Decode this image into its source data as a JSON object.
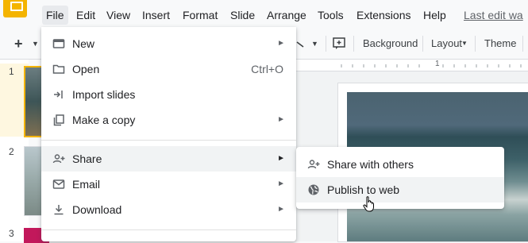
{
  "menubar": {
    "items": [
      "File",
      "Edit",
      "View",
      "Insert",
      "Format",
      "Slide",
      "Arrange",
      "Tools",
      "Extensions",
      "Help"
    ],
    "last_edit": "Last edit wa"
  },
  "toolbar": {
    "add": "+",
    "background": "Background",
    "layout": "Layout",
    "theme": "Theme"
  },
  "filmstrip": {
    "numbers": [
      "1",
      "2",
      "3"
    ]
  },
  "ruler": {
    "mark": "1"
  },
  "file_menu": {
    "items": [
      {
        "label": "New",
        "icon": "new-presentation-icon",
        "submenu": true
      },
      {
        "label": "Open",
        "icon": "folder-icon",
        "shortcut": "Ctrl+O"
      },
      {
        "label": "Import slides",
        "icon": "import-icon"
      },
      {
        "label": "Make a copy",
        "icon": "copy-icon",
        "submenu": true
      },
      {
        "label": "Share",
        "icon": "share-person-icon",
        "submenu": true,
        "highlighted": true
      },
      {
        "label": "Email",
        "icon": "email-icon",
        "submenu": true
      },
      {
        "label": "Download",
        "icon": "download-icon",
        "submenu": true
      }
    ]
  },
  "share_submenu": {
    "items": [
      {
        "label": "Share with others",
        "icon": "share-person-icon"
      },
      {
        "label": "Publish to web",
        "icon": "globe-icon",
        "highlighted": true
      }
    ]
  },
  "colors": {
    "accent": "#f4b400",
    "menu_hover": "#f1f3f4",
    "active_bg": "#e8eaed",
    "selected_slide": "#fef7e0"
  }
}
